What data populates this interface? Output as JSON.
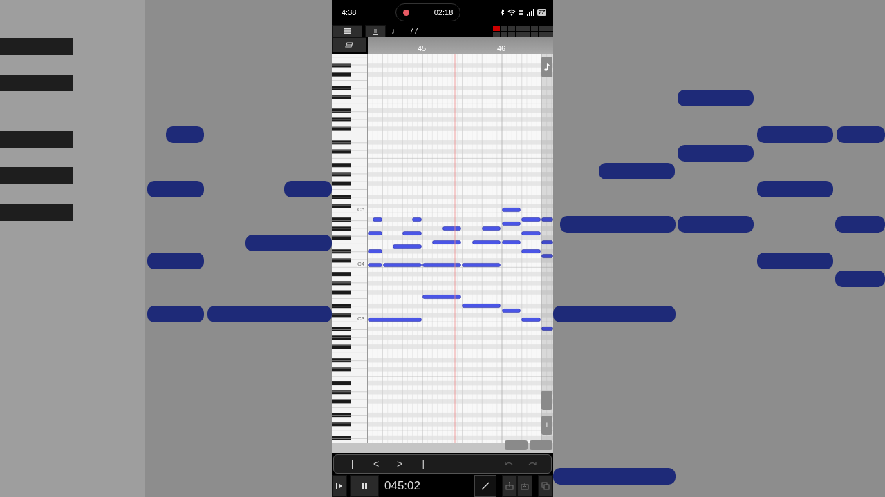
{
  "status_bar": {
    "time": "4:38",
    "recording_time": "02:18",
    "battery": "77"
  },
  "toolbar": {
    "tempo": "♩ = 77",
    "meter": {
      "level": 0.125
    }
  },
  "ruler": {
    "bars": [
      "45",
      "46"
    ]
  },
  "keyboard": {
    "labels": [
      "C5",
      "C4",
      "C3"
    ]
  },
  "zoom_controls": {
    "vertical": [
      "−",
      "+"
    ],
    "horizontal": [
      "−",
      "+"
    ]
  },
  "edit_bar": {
    "buttons": [
      "[",
      "<",
      ">",
      "]"
    ],
    "undo": {
      "disabled": true
    },
    "redo": {
      "disabled": true
    }
  },
  "transport": {
    "playing": true,
    "position": "045:02",
    "pencil": {
      "selected": true
    }
  }
}
